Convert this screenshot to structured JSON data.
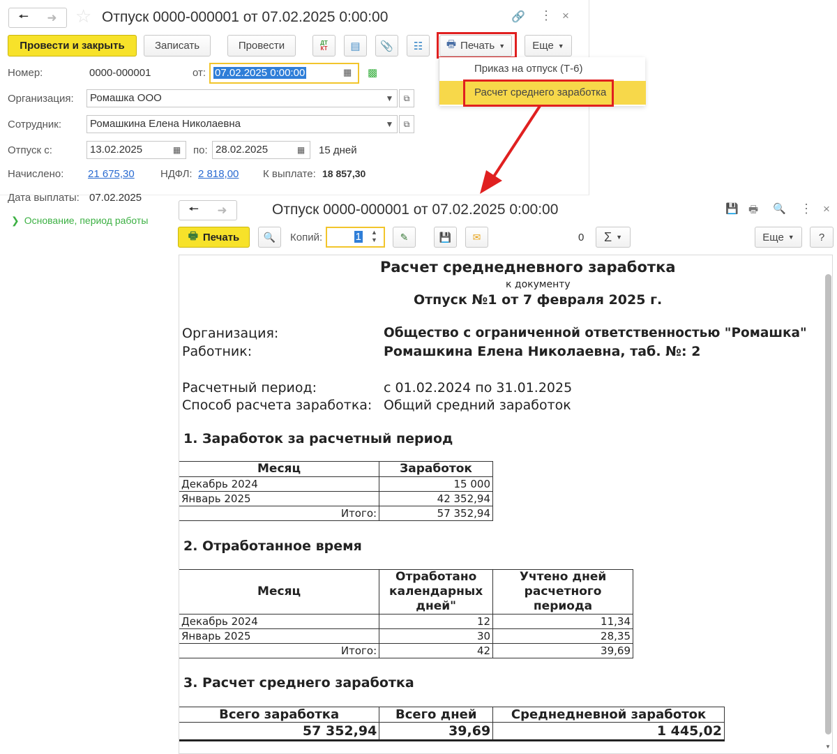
{
  "doc_window": {
    "title": "Отпуск 0000-000001 от 07.02.2025 0:00:00",
    "toolbar": {
      "post_and_close": "Провести и закрыть",
      "save": "Записать",
      "post": "Провести",
      "dt_kt_top": "ДТ",
      "dt_kt_bottom": "КТ",
      "print": "Печать",
      "more": "Еще"
    },
    "print_menu": {
      "items": [
        "Приказ на отпуск (Т-6)",
        "Расчет среднего заработка"
      ]
    },
    "fields": {
      "number_label": "Номер:",
      "number_value": "0000-000001",
      "date_label": "от:",
      "date_value": "07.02.2025  0:00:00",
      "org_label": "Организация:",
      "org_value": "Ромашка ООО",
      "employee_label": "Сотрудник:",
      "employee_value": "Ромашкина Елена Николаевна",
      "vacation_from_label": "Отпуск с:",
      "vacation_from_value": "13.02.2025",
      "vacation_to_label": "по:",
      "vacation_to_value": "28.02.2025",
      "vacation_days": "15 дней",
      "accrued_label": "Начислено:",
      "accrued_value": "21 675,30",
      "ndfl_label": "НДФЛ:",
      "ndfl_value": "2 818,00",
      "to_pay_label": "К выплате:",
      "to_pay_value": "18 857,30",
      "pay_date_label": "Дата выплаты:",
      "pay_date_value": "07.02.2025",
      "basis_link": "Основание, период работы"
    }
  },
  "print_window": {
    "title": "Отпуск 0000-000001 от 07.02.2025 0:00:00",
    "toolbar": {
      "print": "Печать",
      "copies_label": "Копий:",
      "copies_value": "1",
      "sum_value": "0",
      "more": "Еще",
      "help": "?"
    },
    "report": {
      "title": "Расчет среднедневного заработка",
      "subtitle": "к документу",
      "doc_ref": "Отпуск №1 от 7 февраля 2025 г.",
      "org_label": "Организация:",
      "org_value": "Общество с ограниченной ответственностью \"Ромашка\"",
      "worker_label": "Работник:",
      "worker_value": "Ромашкина Елена Николаевна, таб. №: 2",
      "period_label": "Расчетный период:",
      "period_value": "с 01.02.2024 по 31.01.2025",
      "method_label": "Способ расчета заработка:",
      "method_value": "Общий средний заработок",
      "section1": {
        "heading": "1. Заработок за расчетный период",
        "col_month": "Месяц",
        "col_earnings": "Заработок",
        "rows": [
          {
            "month": "Декабрь 2024",
            "earnings": "15 000"
          },
          {
            "month": "Январь 2025",
            "earnings": "42 352,94"
          }
        ],
        "total_label": "Итого:",
        "total_value": "57 352,94"
      },
      "section2": {
        "heading": "2. Отработанное время",
        "col_month": "Месяц",
        "col_worked": "Отработано календарных дней\"",
        "col_counted": "Учтено дней расчетного периода",
        "rows": [
          {
            "month": "Декабрь 2024",
            "worked": "12",
            "counted": "11,34"
          },
          {
            "month": "Январь 2025",
            "worked": "30",
            "counted": "28,35"
          }
        ],
        "total_label": "Итого:",
        "total_worked": "42",
        "total_counted": "39,69"
      },
      "section3": {
        "heading": "3. Расчет среднего  заработка",
        "col_total_earnings": "Всего заработка",
        "col_total_days": "Всего дней",
        "col_avg": "Среднедневной заработок",
        "total_earnings": "57 352,94",
        "total_days": "39,69",
        "avg": "1 445,02"
      }
    }
  },
  "colors": {
    "accent_yellow": "#f7e22a",
    "menu_highlight": "#f7d84a",
    "annotation_red": "#e02020",
    "link_blue": "#2a6bd1",
    "basis_green": "#3cb043"
  }
}
